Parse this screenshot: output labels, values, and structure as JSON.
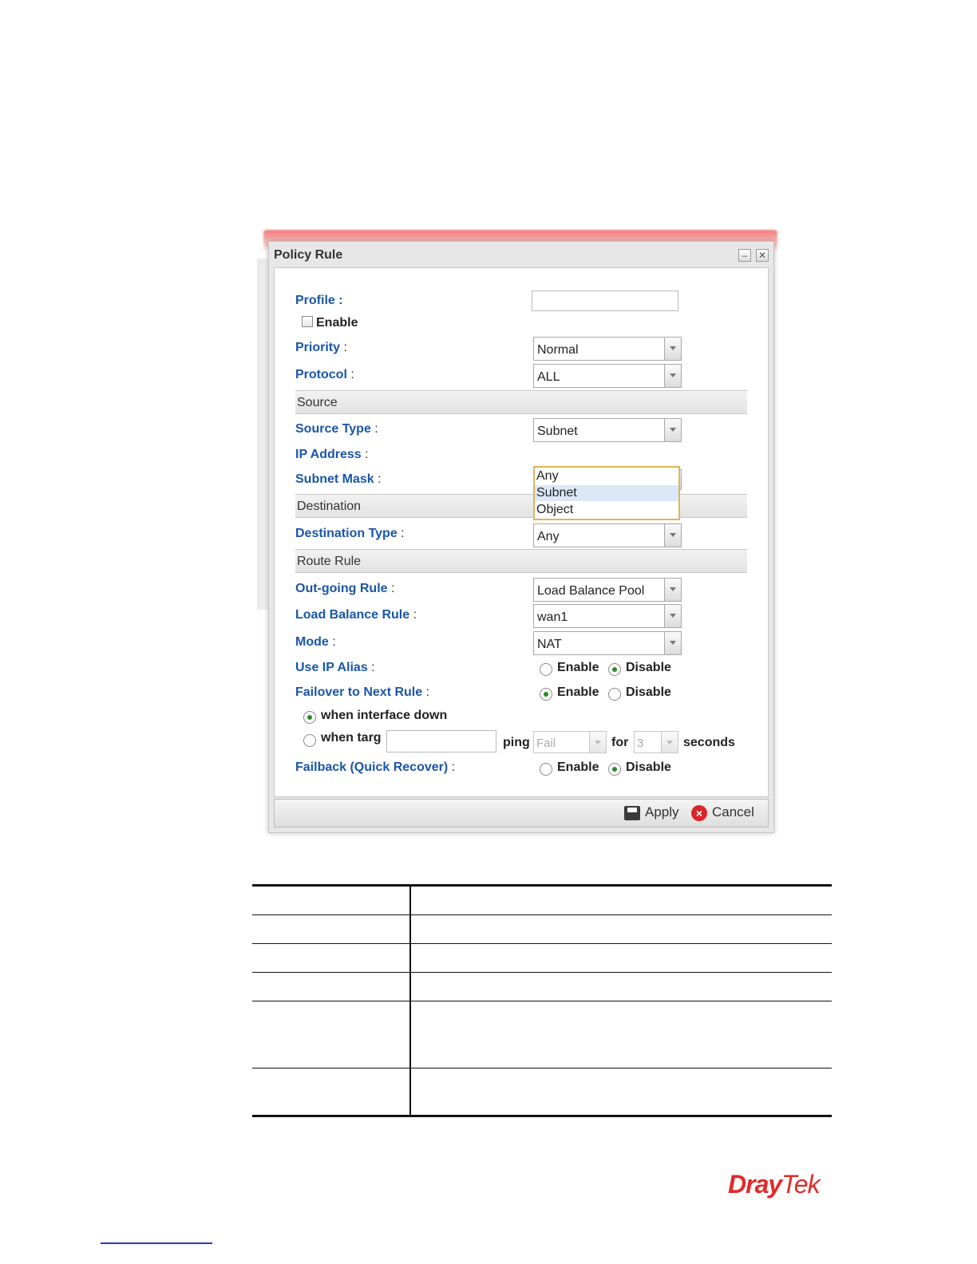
{
  "dialog": {
    "title": "Policy Rule",
    "minimize_icon": "minimize-icon",
    "close_icon": "close-icon",
    "profile": {
      "label": "Profile :",
      "value": ""
    },
    "enable_checkbox": {
      "label": "Enable",
      "checked": false
    },
    "priority": {
      "label": "Priority",
      "sep": ":",
      "value": "Normal"
    },
    "protocol": {
      "label": "Protocol",
      "sep": ":",
      "value": "ALL"
    },
    "sections": {
      "source": "Source",
      "destination": "Destination",
      "route_rule": "Route Rule"
    },
    "source_type": {
      "label": "Source Type",
      "sep": ":",
      "value": "Subnet",
      "options": [
        "Any",
        "Subnet",
        "Object"
      ],
      "highlighted": "Subnet"
    },
    "ip_address": {
      "label": "IP Address",
      "sep": ":"
    },
    "subnet_mask": {
      "label": "Subnet Mask",
      "sep": ":"
    },
    "destination_type": {
      "label": "Destination Type",
      "sep": ":",
      "value": "Any"
    },
    "outgoing_rule": {
      "label": "Out-going Rule",
      "sep": ":",
      "value": "Load Balance Pool"
    },
    "load_balance_rule": {
      "label": "Load Balance Rule",
      "sep": ":",
      "value": "wan1"
    },
    "mode": {
      "label": "Mode",
      "sep": ":",
      "value": "NAT"
    },
    "use_ip_alias": {
      "label": "Use IP Alias",
      "sep": ":",
      "enable": "Enable",
      "disable": "Disable",
      "selected": "Disable"
    },
    "failover": {
      "label": "Failover to Next Rule",
      "sep": ":",
      "enable": "Enable",
      "disable": "Disable",
      "selected": "Enable",
      "when_interface_down": "when interface down",
      "when_target": "when targ",
      "ping": "ping",
      "ping_value": "Fail",
      "for": "for",
      "for_value": "3",
      "seconds": "seconds"
    },
    "failback": {
      "label": "Failback (Quick Recover)",
      "sep": ":",
      "enable": "Enable",
      "disable": "Disable",
      "selected": "Disable"
    },
    "buttons": {
      "apply": "Apply",
      "cancel": "Cancel"
    }
  },
  "logo": {
    "dray": "Dray",
    "tek": "Tek"
  },
  "colors": {
    "label_blue": "#1a56a8",
    "logo_red": "#e02a2a"
  }
}
